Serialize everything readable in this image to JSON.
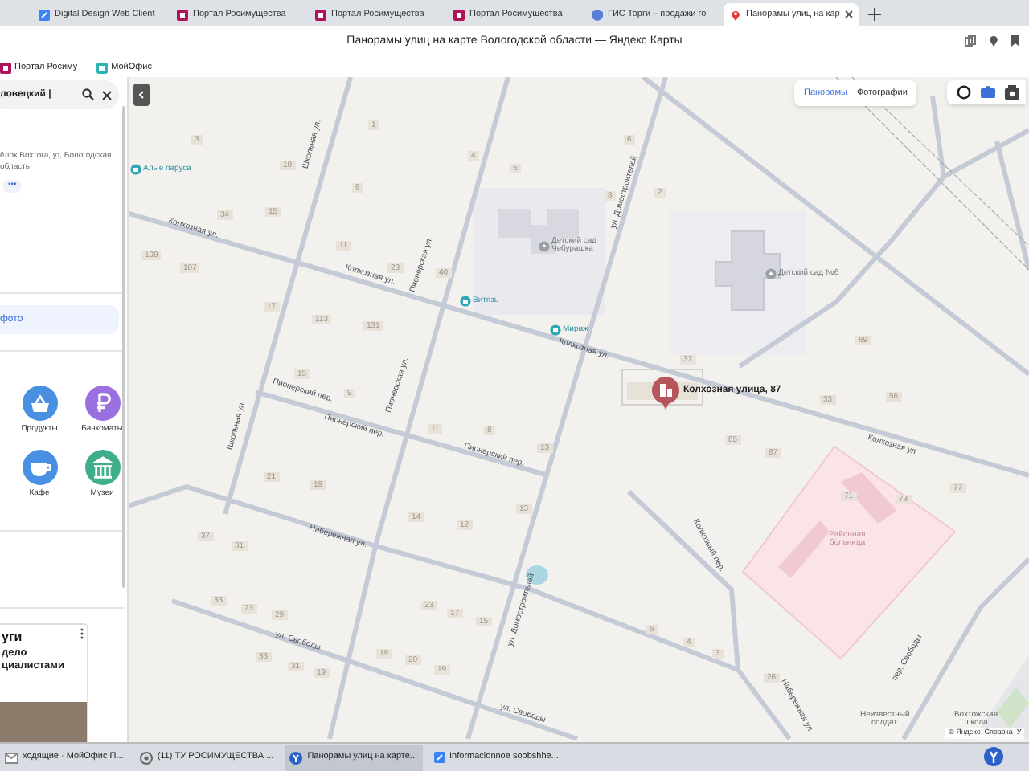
{
  "browser": {
    "tabs": [
      {
        "label": "Digital Design Web Client",
        "kind": "doc",
        "selected": false
      },
      {
        "label": "Портал Росимущества",
        "kind": "portal",
        "selected": false
      },
      {
        "label": "Портал Росимущества",
        "kind": "portal",
        "selected": false
      },
      {
        "label": "Портал Росимущества",
        "kind": "portal",
        "selected": false
      },
      {
        "label": "ГИС Торги – продажи го",
        "kind": "shield",
        "selected": false
      },
      {
        "label": "Панорамы улиц на кар",
        "kind": "pin",
        "selected": true
      }
    ],
    "title": "Панорамы улиц на карте Вологодской области — Яндекс Карты",
    "bookmarks": [
      {
        "label": "Портал Росиму",
        "kind": "portal"
      },
      {
        "label": "МойОфис",
        "kind": "office"
      }
    ]
  },
  "left_panel": {
    "search": {
      "value": "ловецкий |"
    },
    "address": "ёлок Вохтога, ут, Вологодская область·",
    "more": "•••",
    "photo_link": "фото",
    "categories": [
      {
        "label": "Продукты",
        "kind": "basket",
        "color": "#4a90e2"
      },
      {
        "label": "Банкоматы",
        "kind": "ruble",
        "color": "#9a6fe0"
      },
      {
        "label": "Кафе",
        "kind": "cup",
        "color": "#4a90e2"
      },
      {
        "label": "Музеи",
        "kind": "museum",
        "color": "#3fae8c"
      }
    ],
    "ad": {
      "title": "уги",
      "lines": [
        "дело",
        "циалистами"
      ]
    }
  },
  "map": {
    "modes": [
      {
        "label": "Панорамы",
        "selected": true
      },
      {
        "label": "Фотографии",
        "selected": false
      }
    ],
    "pin": {
      "label": "Колхозная улица, 87"
    },
    "pois": [
      {
        "label": "Алые паруса",
        "kind": "shop"
      },
      {
        "label": "Детский сад Чебурашка",
        "kind": "school"
      },
      {
        "label": "Витязь",
        "kind": "shop"
      },
      {
        "label": "Мираж",
        "kind": "shop"
      },
      {
        "label": "Детский сад №6",
        "kind": "school"
      },
      {
        "label": "Районная больница",
        "kind": "hospital"
      },
      {
        "label": "Неизвестный солдат",
        "kind": "place"
      },
      {
        "label": "Вохтожская школа",
        "kind": "place"
      }
    ],
    "streets": [
      "Колхозная ул.",
      "Колхозная ул.",
      "Колхозная ул.",
      "Колхозная ул.",
      "Школьная ул.",
      "Школьная ул.",
      "Пионерская ул.",
      "Пионерская ул.",
      "Пионерский пер.",
      "Пионерский пер.",
      "Пионерский пер.",
      "Набережная ул.",
      "ул. Свободы",
      "ул. Свободы",
      "ул. Домостроителей",
      "ул. Домостроителей",
      "Колхозный пер.",
      "Набережная ул.",
      "пер. Свободы"
    ],
    "house_numbers": [
      "1",
      "3",
      "19",
      "9",
      "4",
      "5",
      "6",
      "8",
      "2",
      "34",
      "15",
      "11",
      "23",
      "40",
      "113",
      "131",
      "107",
      "109",
      "17",
      "15",
      "9",
      "11",
      "8",
      "13",
      "37",
      "85",
      "87",
      "33",
      "69",
      "56",
      "71",
      "73",
      "77",
      "13",
      "14",
      "12",
      "19",
      "21",
      "37",
      "31",
      "23",
      "17",
      "15",
      "33",
      "23",
      "29",
      "33",
      "31",
      "19",
      "19",
      "20",
      "19",
      "3",
      "6",
      "4",
      "26"
    ],
    "attribution": "© Яндекс  Справка  У"
  },
  "taskbar": [
    {
      "label": "ходящие · МойОфис П...",
      "kind": "mail",
      "selected": false
    },
    {
      "label": "(11) ТУ РОСИМУЩЕСТВА ...",
      "kind": "chrome",
      "selected": false
    },
    {
      "label": "Панорамы улиц на карте...",
      "kind": "yandex",
      "selected": true
    },
    {
      "label": "Informacionnoe soobshhe...",
      "kind": "doc",
      "selected": false
    }
  ]
}
